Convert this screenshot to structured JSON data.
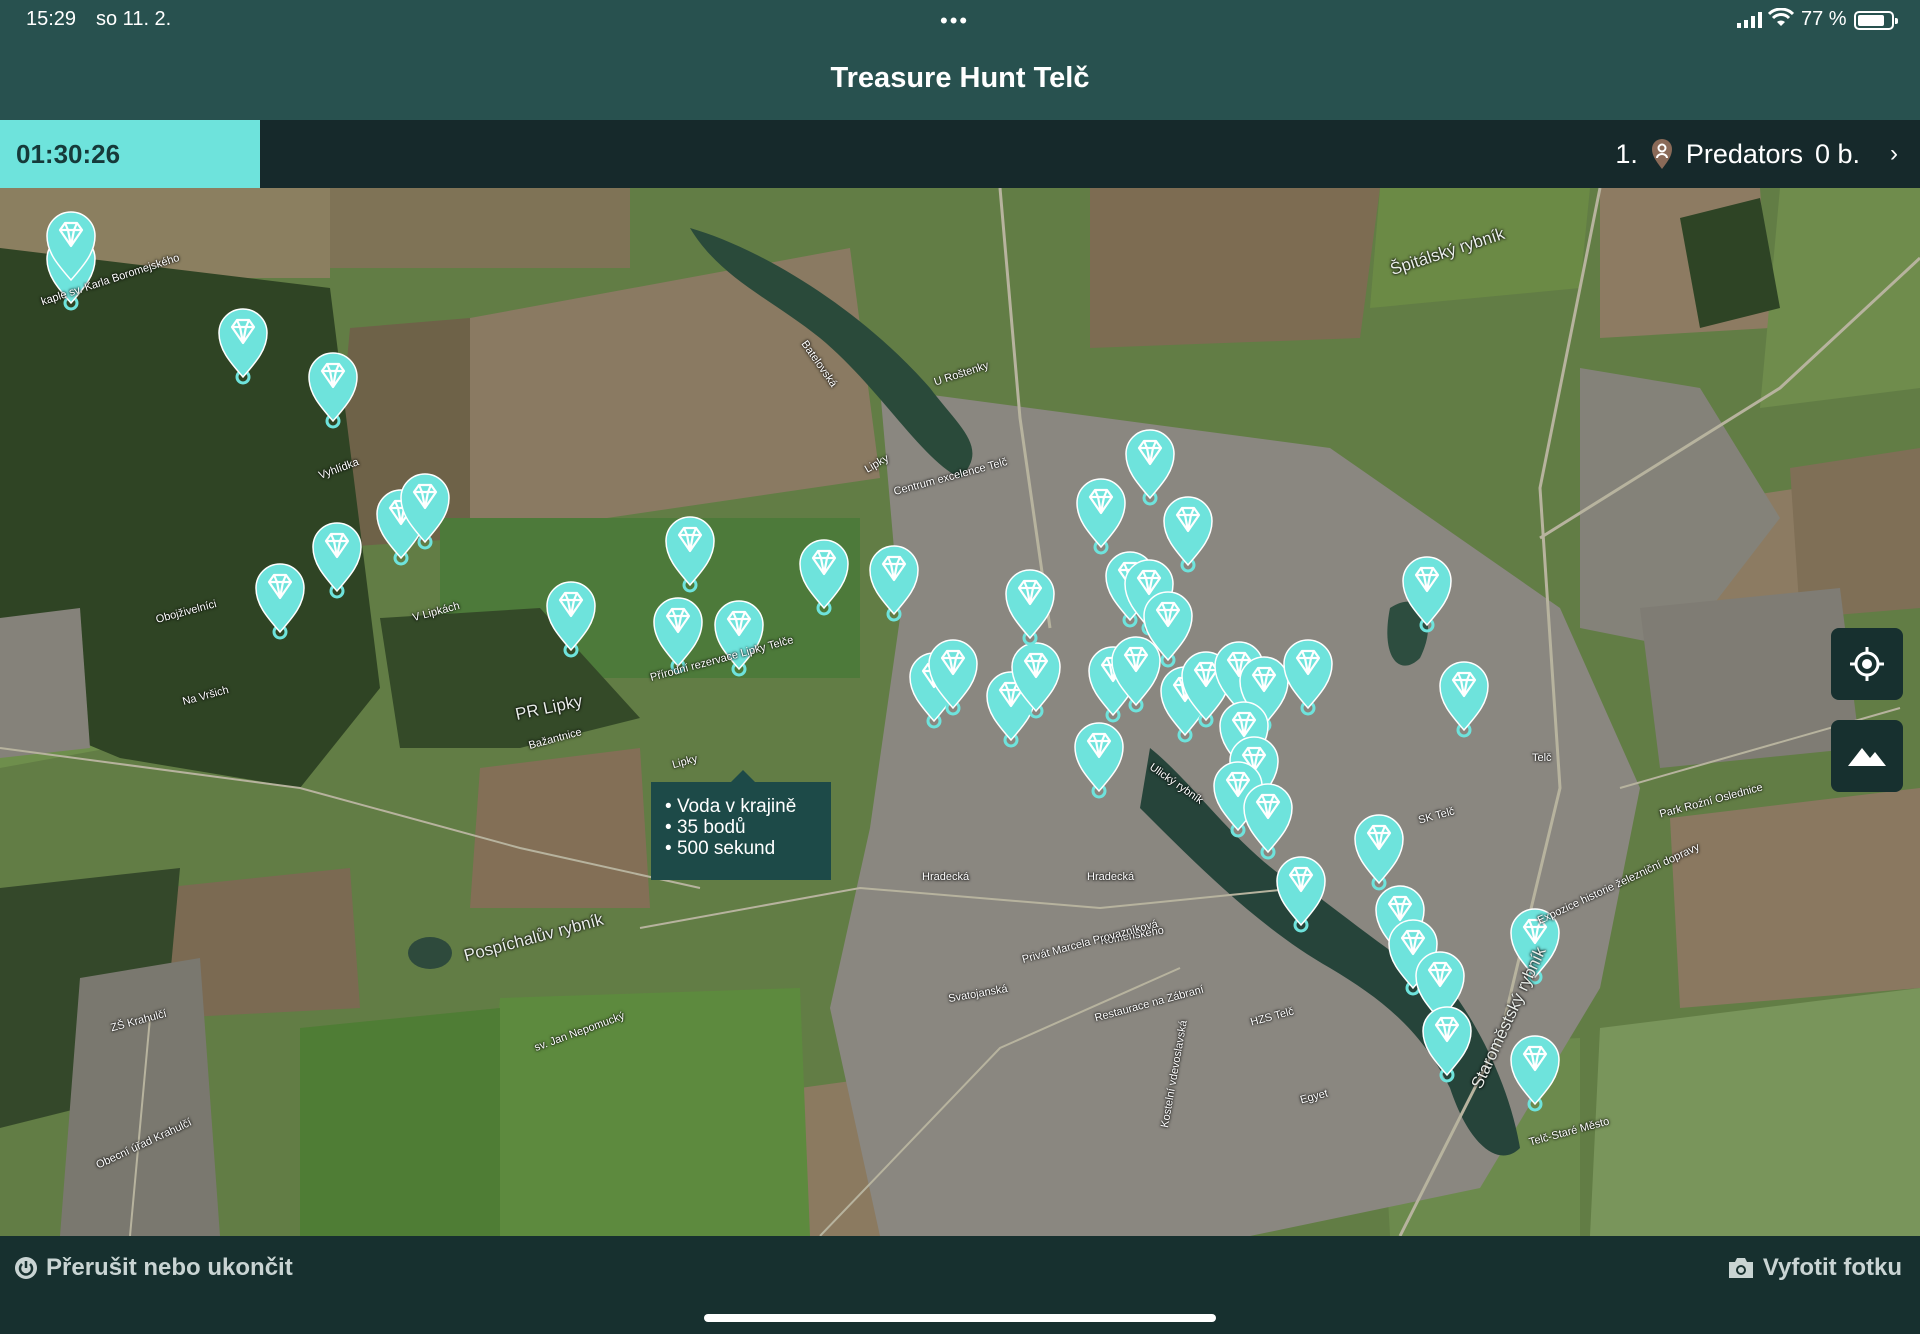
{
  "status_bar": {
    "time": "15:29",
    "date": "so 11. 2.",
    "dots": "•••",
    "battery": "77 %"
  },
  "app": {
    "title": "Treasure Hunt Telč"
  },
  "game_bar": {
    "timer": "01:30:26",
    "rank": "1.",
    "team_name": "Predators",
    "score": "0 b.",
    "chevron": "›"
  },
  "map": {
    "marker_icon": "diamond-pin-icon",
    "marker_color": "#6ee3dc",
    "labels": {
      "kaple": "kaple sv. Karla Boromejského",
      "vyhlidka": "Vyhlídka",
      "obojzivelnici": "Obojživelníci",
      "na_vrsich": "Na Vršich",
      "v_lipkach": "V Lipkách",
      "pr": "PR Lipky",
      "bazantnice": "Bažantnice",
      "prirodni": "Přírodní rezervace Lipky Telče",
      "lipky1": "Lipky",
      "lipky2": "Lipky",
      "centrum": "Centrum excelence Telč",
      "u_rostenky": "U Roštenky",
      "batelovska": "Batelovská",
      "spitalsky": "Špitálský rybník",
      "pospichaluv": "Pospíchalův rybník",
      "hradecka1": "Hradecká",
      "hradecka2": "Hradecká",
      "komenskeho": "Komenského",
      "privat": "Privát Marcela Provazníková",
      "restaurace": "Restaurace na Zábraní",
      "svatojanska": "Svatojanská",
      "sk_telc": "SK Telč",
      "telc": "Telč",
      "park": "Park Roźní Oslednice",
      "expozice": "Expozice historie železniční dopravy",
      "telc_stare": "Telč-Staré Město",
      "kostelni": "Kostelní vdevoslavská",
      "zs_krahulci": "ZŠ Krahulčí",
      "obecni_urad": "Obecní úřad Krahulčí",
      "sv_jan": "sv. Jan Nepomucký",
      "ulicni_rybnik": "Ulický rybník",
      "staromestsky": "Staroměstský rybník",
      "hzs": "HZS Telč",
      "egyet": "Egyet"
    },
    "tooltip": {
      "line1": "Voda v krajině",
      "line2": "35 bodů",
      "line3": "500 sekund"
    },
    "controls": {
      "locate_icon": "crosshair-icon",
      "layers_icon": "mountain-icon"
    }
  },
  "bottom_bar": {
    "quit_label": "Přerušit nebo ukončit",
    "photo_label": "Vyfotit fotku"
  }
}
